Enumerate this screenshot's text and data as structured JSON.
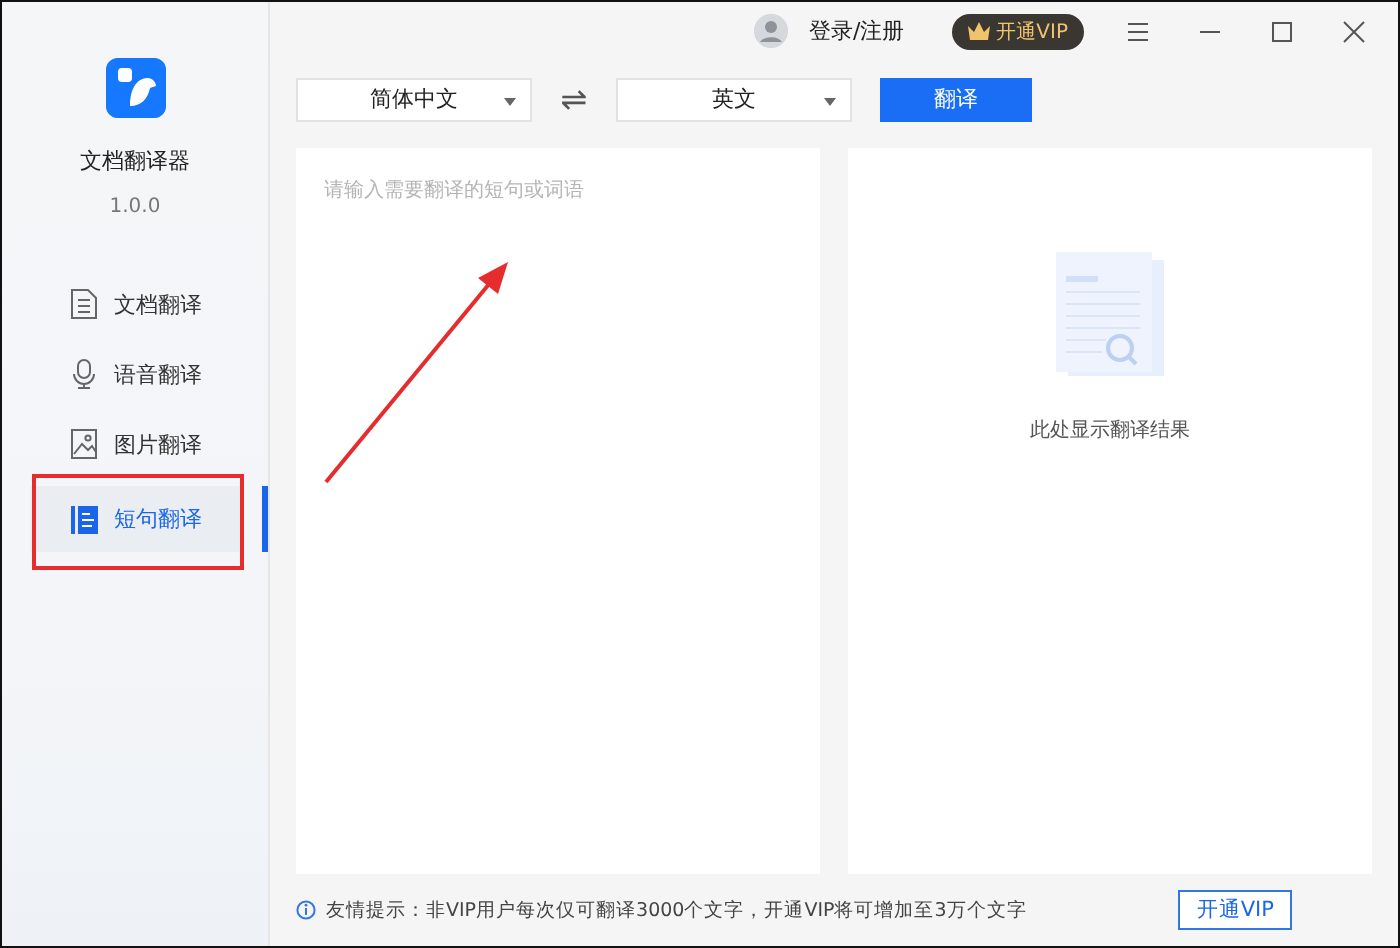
{
  "app": {
    "name": "文档翻译器",
    "version": "1.0.0"
  },
  "sidebar": {
    "items": [
      {
        "label": "文档翻译",
        "selected": false
      },
      {
        "label": "语音翻译",
        "selected": false
      },
      {
        "label": "图片翻译",
        "selected": false
      },
      {
        "label": "短句翻译",
        "selected": true
      }
    ]
  },
  "top_bar": {
    "login": "登录/注册",
    "vip_button": "开通VIP"
  },
  "toolbar": {
    "source_language": "简体中文",
    "swap": "⇌",
    "target_language": "英文",
    "translate_button": "翻译"
  },
  "input_panel": {
    "placeholder": "请输入需要翻译的短句或词语"
  },
  "result_panel": {
    "empty_text": "此处显示翻译结果"
  },
  "footer": {
    "tip": "友情提示：非VIP用户每次仅可翻译3000个文字，开通VIP将可增加至3万个文字",
    "vip_button": "开通VIP"
  }
}
